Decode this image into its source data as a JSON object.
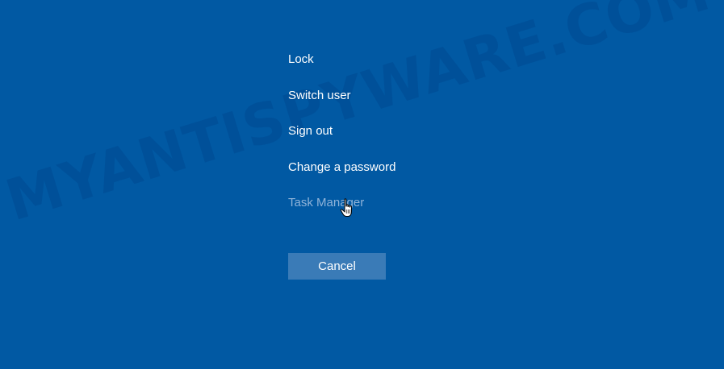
{
  "watermark": "MYANTISPYWARE.COM",
  "menu": {
    "items": [
      {
        "label": "Lock"
      },
      {
        "label": "Switch user"
      },
      {
        "label": "Sign out"
      },
      {
        "label": "Change a password"
      },
      {
        "label": "Task Manager"
      }
    ],
    "hovered_item": "Task Manager"
  },
  "cancel_label": "Cancel",
  "cursor_icon": "hand-pointer-icon",
  "colors": {
    "background": "#0159A3",
    "text": "#FFFFFF",
    "hover_text": "#8FB3D9",
    "button": "#3A7BB7"
  }
}
